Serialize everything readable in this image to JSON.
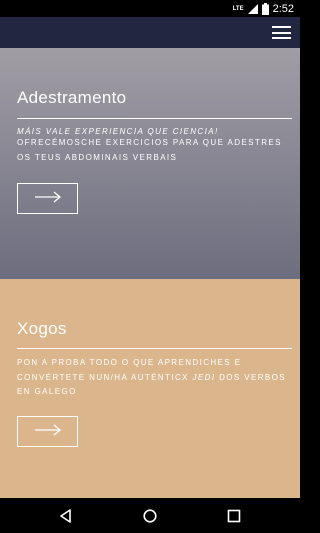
{
  "status_bar": {
    "network": "LTE",
    "time": "2:52",
    "icons": [
      "signal-icon",
      "battery-icon"
    ]
  },
  "app_bar": {
    "menu_icon": "hamburger-menu-icon"
  },
  "cards": [
    {
      "title": "Adestramento",
      "subtitle": "MÁIS VALE EXPERIENCIA QUE CIENCIA!",
      "text": "OFRECÉMOSCHE EXERCICIOS PARA QUE ADESTRES OS TEUS ABDOMINAIS VERBAIS",
      "action_icon": "arrow-right-icon",
      "background": "#8a8894"
    },
    {
      "title": "Xogos",
      "text_before": "PON A PROBA TODO O QUE APRENDICHES E CONVÉRTETE NUN/HA AUTÉNTICX ",
      "text_emphasis": "JEDI",
      "text_after": " DOS VERBOS EN GALEGO",
      "action_icon": "arrow-right-icon",
      "background": "#dbb68d"
    }
  ],
  "nav_bar": {
    "buttons": [
      "back-icon",
      "home-icon",
      "recents-icon"
    ]
  }
}
